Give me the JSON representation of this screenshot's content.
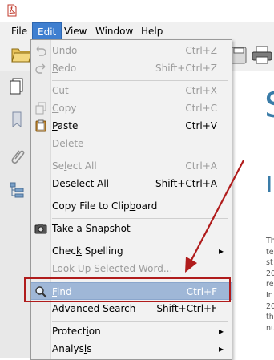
{
  "menubar": {
    "items": [
      {
        "label": "File"
      },
      {
        "label": "Edit"
      },
      {
        "label": "View"
      },
      {
        "label": "Window"
      },
      {
        "label": "Help"
      }
    ]
  },
  "document": {
    "heading_char": "S",
    "subheading_char": "I",
    "text_lines": [
      "Th",
      "te",
      "st",
      "20",
      "re",
      "In",
      "20",
      "th",
      "nu"
    ]
  },
  "edit_menu": {
    "items": [
      {
        "label_pre": "",
        "label_u": "U",
        "label_post": "ndo",
        "shortcut": "Ctrl+Z",
        "disabled": true,
        "icon": "undo-icon"
      },
      {
        "label_pre": "",
        "label_u": "R",
        "label_post": "edo",
        "shortcut": "Shift+Ctrl+Z",
        "disabled": true,
        "icon": "redo-icon"
      },
      {
        "label_pre": "Cu",
        "label_u": "t",
        "label_post": "",
        "shortcut": "Ctrl+X",
        "disabled": true,
        "icon": ""
      },
      {
        "label_pre": "",
        "label_u": "C",
        "label_post": "opy",
        "shortcut": "Ctrl+C",
        "disabled": true,
        "icon": "copy-icon"
      },
      {
        "label_pre": "",
        "label_u": "P",
        "label_post": "aste",
        "shortcut": "Ctrl+V",
        "disabled": false,
        "icon": "paste-icon"
      },
      {
        "label_pre": "",
        "label_u": "D",
        "label_post": "elete",
        "shortcut": "",
        "disabled": true,
        "icon": ""
      },
      {
        "label_pre": "Se",
        "label_u": "l",
        "label_post": "ect All",
        "shortcut": "Ctrl+A",
        "disabled": true,
        "icon": ""
      },
      {
        "label_pre": "D",
        "label_u": "e",
        "label_post": "select All",
        "shortcut": "Shift+Ctrl+A",
        "disabled": false,
        "icon": ""
      },
      {
        "label_pre": "Copy File to Clip",
        "label_u": "b",
        "label_post": "oard",
        "shortcut": "",
        "disabled": false,
        "icon": ""
      },
      {
        "label_pre": "T",
        "label_u": "a",
        "label_post": "ke a Snapshot",
        "shortcut": "",
        "disabled": false,
        "icon": "camera-icon"
      },
      {
        "label_pre": "Chec",
        "label_u": "k",
        "label_post": " Spelling",
        "shortcut": "",
        "disabled": false,
        "icon": "",
        "submenu": true
      },
      {
        "label_pre": "Look Up Selected Word...",
        "label_u": "",
        "label_post": "",
        "shortcut": "",
        "disabled": true,
        "icon": ""
      },
      {
        "label_pre": "",
        "label_u": "F",
        "label_post": "ind",
        "shortcut": "Ctrl+F",
        "disabled": false,
        "icon": "search-icon",
        "highlighted": true
      },
      {
        "label_pre": "Ad",
        "label_u": "v",
        "label_post": "anced Search",
        "shortcut": "Shift+Ctrl+F",
        "disabled": false,
        "icon": ""
      },
      {
        "label_pre": "Protect",
        "label_u": "i",
        "label_post": "on",
        "shortcut": "",
        "disabled": false,
        "icon": "",
        "submenu": true
      },
      {
        "label_pre": "Analys",
        "label_u": "i",
        "label_post": "s",
        "shortcut": "",
        "disabled": false,
        "icon": "",
        "submenu": true
      }
    ]
  },
  "colors": {
    "menu_active": "#3f7fd0",
    "highlight": "#9fb7d7",
    "annotation_red": "#b01c1c",
    "doc_accent": "#3a7ca8"
  }
}
